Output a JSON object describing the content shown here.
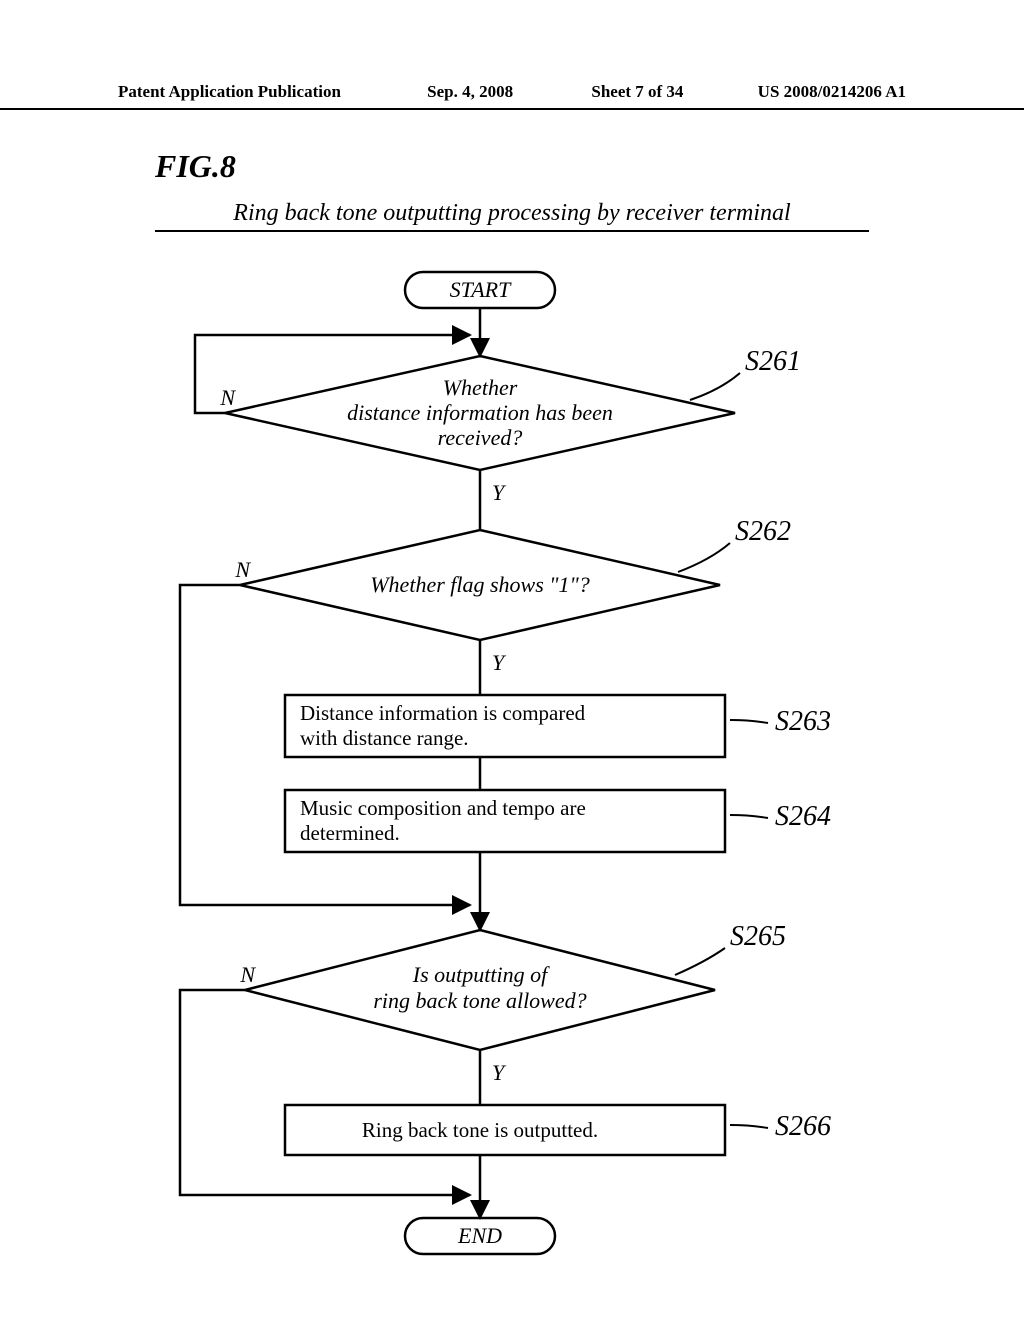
{
  "header": {
    "pub": "Patent Application Publication",
    "date": "Sep. 4, 2008",
    "sheet": "Sheet 7 of 34",
    "docnum": "US 2008/0214206 A1"
  },
  "figure_label": "FIG.8",
  "subtitle": "Ring back tone outputting processing by receiver terminal",
  "flow": {
    "start": "START",
    "end": "END",
    "yes": "Y",
    "no": "N",
    "s261": {
      "label": "S261",
      "l1": "Whether",
      "l2": "distance information has been",
      "l3": "received?"
    },
    "s262": {
      "label": "S262",
      "l1": "Whether flag shows \"1\"?"
    },
    "s263": {
      "label": "S263",
      "l1": "Distance information is compared",
      "l2": "with distance range."
    },
    "s264": {
      "label": "S264",
      "l1": "Music composition and tempo are",
      "l2": "determined."
    },
    "s265": {
      "label": "S265",
      "l1": "Is outputting of",
      "l2": "ring back tone allowed?"
    },
    "s266": {
      "label": "S266",
      "l1": "Ring back tone is outputted."
    }
  }
}
